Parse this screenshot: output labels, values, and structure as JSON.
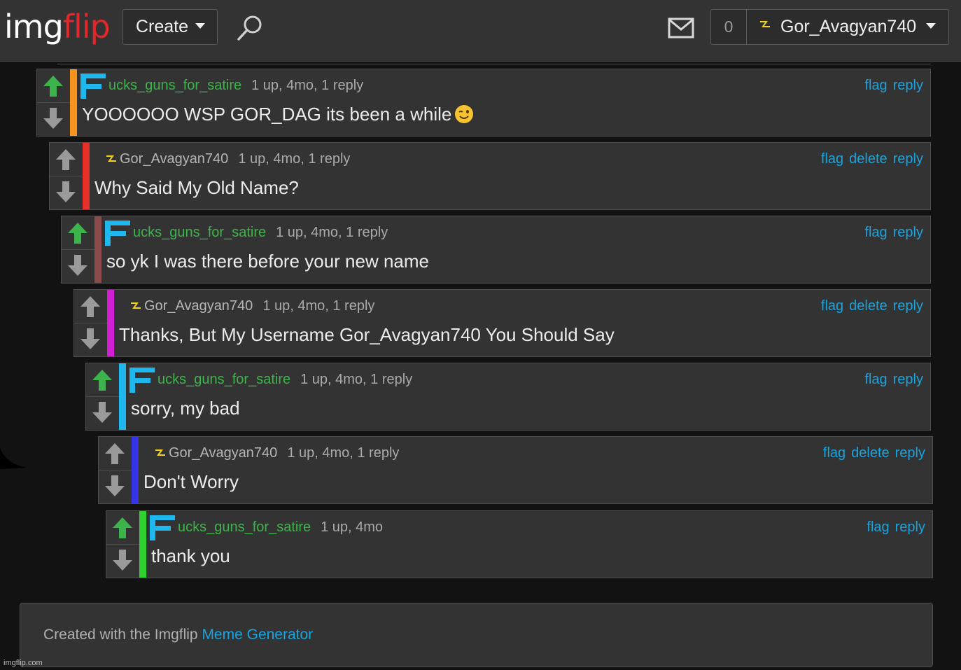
{
  "header": {
    "logo_img": "img",
    "logo_flip": "flip",
    "create_label": "Create",
    "notification_count": "0",
    "username": "Gor_Avagyan740",
    "icons": [
      "search-icon",
      "mail-icon",
      "bolt-icon",
      "chevron-down-icon"
    ]
  },
  "comments": [
    {
      "user": "ucks_guns_for_satire",
      "meta": "1 up, 4mo, 1 reply",
      "text": "YOOOOOO WSP GOR_DAG its been a while",
      "actions": [
        "flag",
        "reply"
      ],
      "bar_color": "#f7941d",
      "upvoted": true
    },
    {
      "user": "Gor_Avagyan740",
      "meta": "1 up, 4mo, 1 reply",
      "text": "Why Said My Old Name?",
      "actions": [
        "flag",
        "delete",
        "reply"
      ],
      "bar_color": "#e8302b",
      "upvoted": false
    },
    {
      "user": "ucks_guns_for_satire",
      "meta": "1 up, 4mo, 1 reply",
      "text": "so yk I was there before your new name",
      "actions": [
        "flag",
        "reply"
      ],
      "bar_color": "#8b4a4a",
      "upvoted": true
    },
    {
      "user": "Gor_Avagyan740",
      "meta": "1 up, 4mo, 1 reply",
      "text": "Thanks, But My Username Gor_Avagyan740 You Should Say",
      "actions": [
        "flag",
        "delete",
        "reply"
      ],
      "bar_color": "#d21fd6",
      "upvoted": false
    },
    {
      "user": "ucks_guns_for_satire",
      "meta": "1 up, 4mo, 1 reply",
      "text": "sorry, my bad",
      "actions": [
        "flag",
        "reply"
      ],
      "bar_color": "#1fb8ee",
      "upvoted": true
    },
    {
      "user": "Gor_Avagyan740",
      "meta": "1 up, 4mo, 1 reply",
      "text": "Don't Worry",
      "actions": [
        "flag",
        "delete",
        "reply"
      ],
      "bar_color": "#3535e6",
      "upvoted": false
    },
    {
      "user": "ucks_guns_for_satire",
      "meta": "1 up, 4mo",
      "text": "thank you",
      "actions": [
        "flag",
        "reply"
      ],
      "bar_color": "#2ed12e",
      "upvoted": true
    }
  ],
  "footer": {
    "prefix": "Created with the Imgflip ",
    "link": "Meme Generator",
    "watermark": "imgflip.com"
  },
  "colors": {
    "link": "#1aa3dd",
    "username_green": "#3db44b",
    "upvote_green": "#3db44b",
    "badge_blue": "#1fb8ee",
    "bolt_yellow": "#f2d21a"
  }
}
